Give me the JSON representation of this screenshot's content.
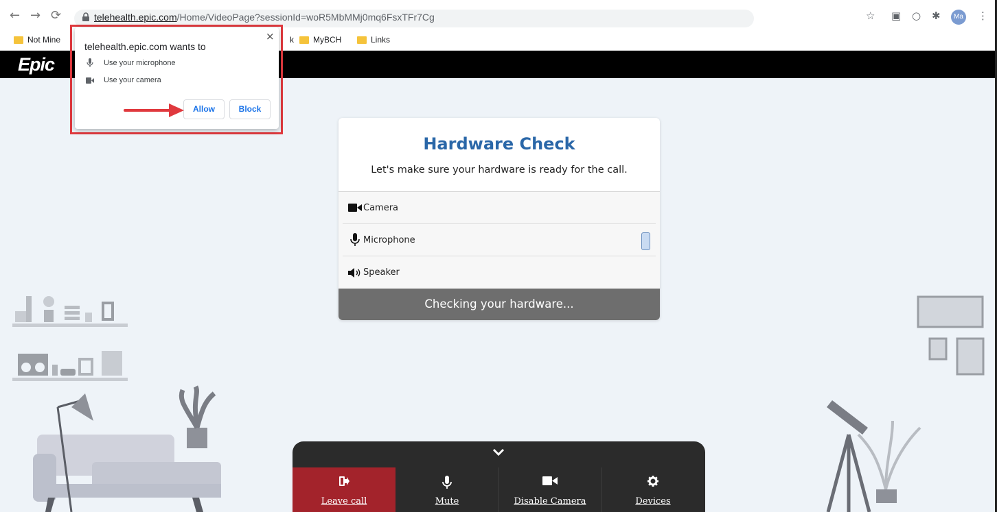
{
  "browser": {
    "url_domain": "telehealth.epic.com",
    "url_path": "/Home/VideoPage?sessionId=woR5MbMMj0mq6FsxTFr7Cg",
    "profile_initials": "Ma"
  },
  "bookmarks": [
    {
      "label": "Not Mine"
    },
    {
      "label": "k"
    },
    {
      "label": "MyBCH"
    },
    {
      "label": "Links"
    }
  ],
  "header": {
    "logo_text": "Epic"
  },
  "permission_popup": {
    "title": "telehealth.epic.com wants to",
    "items": [
      {
        "label": "Use your microphone",
        "icon": "microphone-icon"
      },
      {
        "label": "Use your camera",
        "icon": "camera-icon"
      }
    ],
    "allow_label": "Allow",
    "block_label": "Block",
    "close_glyph": "×"
  },
  "hardware_check": {
    "title": "Hardware Check",
    "subtitle": "Let's make sure your hardware is ready for the call.",
    "devices": [
      {
        "label": "Camera",
        "icon": "camera-icon"
      },
      {
        "label": "Microphone",
        "icon": "microphone-icon"
      },
      {
        "label": "Speaker",
        "icon": "speaker-icon"
      }
    ],
    "status": "Checking your hardware..."
  },
  "call_controls": {
    "leave_label": "Leave call",
    "mute_label": "Mute",
    "camera_label": "Disable Camera",
    "devices_label": "Devices"
  },
  "colors": {
    "brand_blue": "#2a67a8",
    "leave_red": "#a3232b",
    "highlight_red": "#e0393e",
    "link_blue": "#1a73e8"
  }
}
